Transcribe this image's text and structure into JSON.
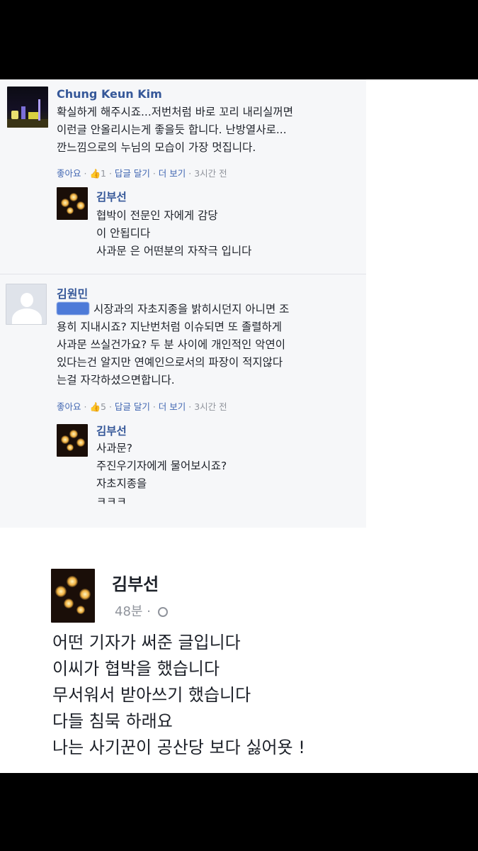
{
  "comment1": {
    "author": "Chung Keun Kim",
    "lines": [
      "확실하게 해주시죠...저번처럼 바로 꼬리 내리실꺼면",
      "이런글 안올리시는게 좋을듯 합니다. 난방열사로...",
      "깐느낌으로의 누님의 모습이 가장 멋집니다."
    ],
    "meta": {
      "like": "좋아요",
      "like_count": "1",
      "reply": "답글 달기",
      "more": "더 보기",
      "time": "3시간 전"
    },
    "reply": {
      "author": "김부선",
      "lines": [
        "협박이 전문인 자에게 감당",
        "이 안됩디다",
        "사과문 은 어떤분의 자작극 입니다"
      ]
    }
  },
  "comment2": {
    "author": "김원민",
    "lines": [
      "시장과의 자초지종을 밝히시던지 아니면 조",
      "용히 지내시죠? 지난번처럼 이슈되면 또 졸렬하게",
      "사과문 쓰실건가요? 두 분 사이에 개인적인 악연이",
      "있다는건 알지만 연예인으로서의 파장이 적지않다",
      "는걸 자각하셨으면합니다."
    ],
    "meta": {
      "like": "좋아요",
      "like_count": "5",
      "reply": "답글 달기",
      "more": "더 보기",
      "time": "3시간 전"
    },
    "reply": {
      "author": "김부선",
      "lines": [
        "사과문?",
        "주진우기자에게 물어보시죠?",
        "자초지종을",
        "ㅋㅋㅋ"
      ]
    }
  },
  "post": {
    "author": "김부선",
    "time": "48분",
    "lines": [
      "어떤 기자가 써준 글입니다",
      "이씨가  협박을 했습니다",
      "무서워서 받아쓰기 했습니다",
      "다들 침묵 하래요",
      "나는 사기꾼이 공산당  보다  싫어욧 !"
    ]
  }
}
